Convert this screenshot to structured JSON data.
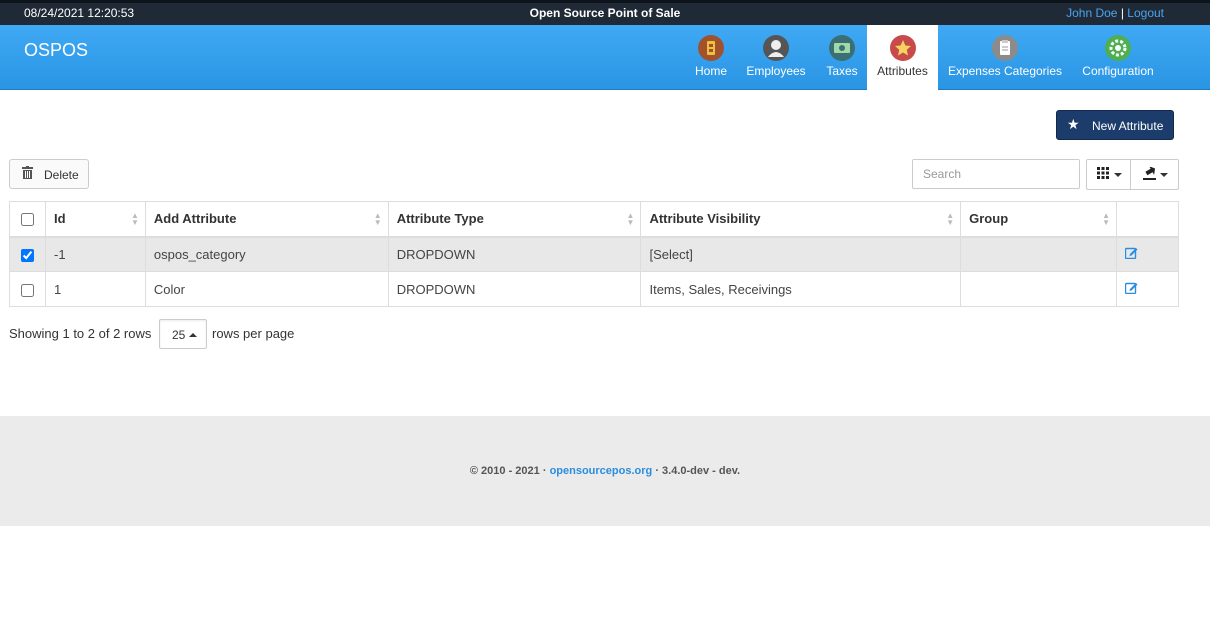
{
  "topbar": {
    "datetime": "08/24/2021 12:20:53",
    "app_title": "Open Source Point of Sale",
    "user_name": "John Doe",
    "separator": "|",
    "logout": "Logout"
  },
  "nav": {
    "brand": "OSPOS",
    "items": [
      {
        "label": "Home",
        "icon": "home-icon",
        "color": "#a0522d"
      },
      {
        "label": "Employees",
        "icon": "employee-icon",
        "color": "#555555"
      },
      {
        "label": "Taxes",
        "icon": "tax-icon",
        "color": "#3b6f74"
      },
      {
        "label": "Attributes",
        "icon": "star-icon",
        "color": "#c94a4a",
        "active": true
      },
      {
        "label": "Expenses Categories",
        "icon": "clipboard-icon",
        "color": "#8b8b8b"
      },
      {
        "label": "Configuration",
        "icon": "gear-icon",
        "color": "#4caf50"
      }
    ]
  },
  "toolbar": {
    "new_label": "New Attribute",
    "delete_label": "Delete",
    "search_placeholder": "Search"
  },
  "table": {
    "columns": [
      "Id",
      "Add Attribute",
      "Attribute Type",
      "Attribute Visibility",
      "Group"
    ],
    "rows": [
      {
        "checked": true,
        "id": "-1",
        "name": "ospos_category",
        "type": "DROPDOWN",
        "visibility": "[Select]",
        "group": ""
      },
      {
        "checked": false,
        "id": "1",
        "name": "Color",
        "type": "DROPDOWN",
        "visibility": "Items, Sales, Receivings",
        "group": ""
      }
    ]
  },
  "pagination": {
    "showing": "Showing 1 to 2 of 2 rows",
    "page_size": "25",
    "per_page": "rows per page"
  },
  "footer": {
    "prefix": "© 2010 - 2021 ·",
    "link": "opensourcepos.org",
    "suffix": "· 3.4.0-dev - dev."
  }
}
